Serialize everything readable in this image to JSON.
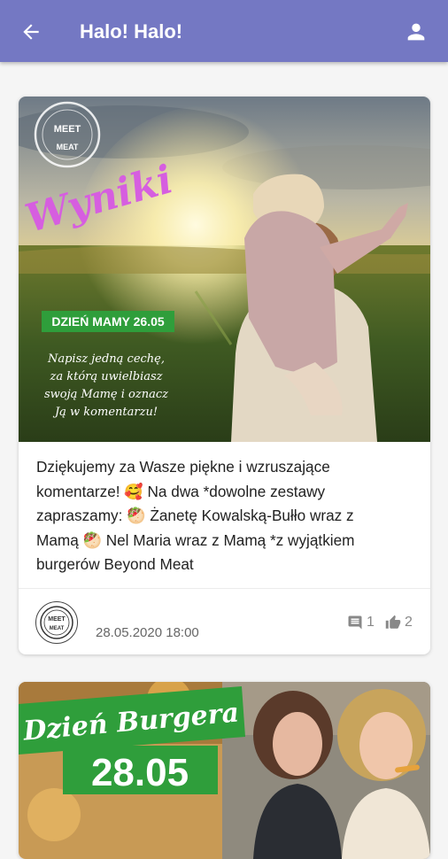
{
  "appbar": {
    "title": "Halo! Halo!",
    "back_icon": "arrow-left-icon",
    "profile_icon": "person-icon",
    "color": "#7478c3"
  },
  "posts": [
    {
      "image": {
        "logo_top": "MEET",
        "logo_bottom": "MEAT",
        "headline": "Wyniki",
        "tag": "DZIEŃ MAMY 26.05",
        "caption_lines": [
          "Napisz jedną cechę,",
          "za którą uwielbiasz",
          "swoją Mamę i oznacz",
          "Ją w komentarzu!"
        ]
      },
      "text_lines": [
        "Dziękujemy za Wasze piękne i wzruszające",
        "komentarze! 🥰  Na dwa *dowolne zestawy",
        "zapraszamy: 🥙 Żanetę Kowalską-Bułło wraz z",
        "Mamą 🥙 Nel Maria wraz z Mamą *z wyjątkiem",
        "burgerów Beyond Meat"
      ],
      "date": "28.05.2020 18:00",
      "comments": "1",
      "likes": "2"
    },
    {
      "image": {
        "headline": "Dzień Burgera",
        "date_badge": "28.05"
      }
    }
  ]
}
